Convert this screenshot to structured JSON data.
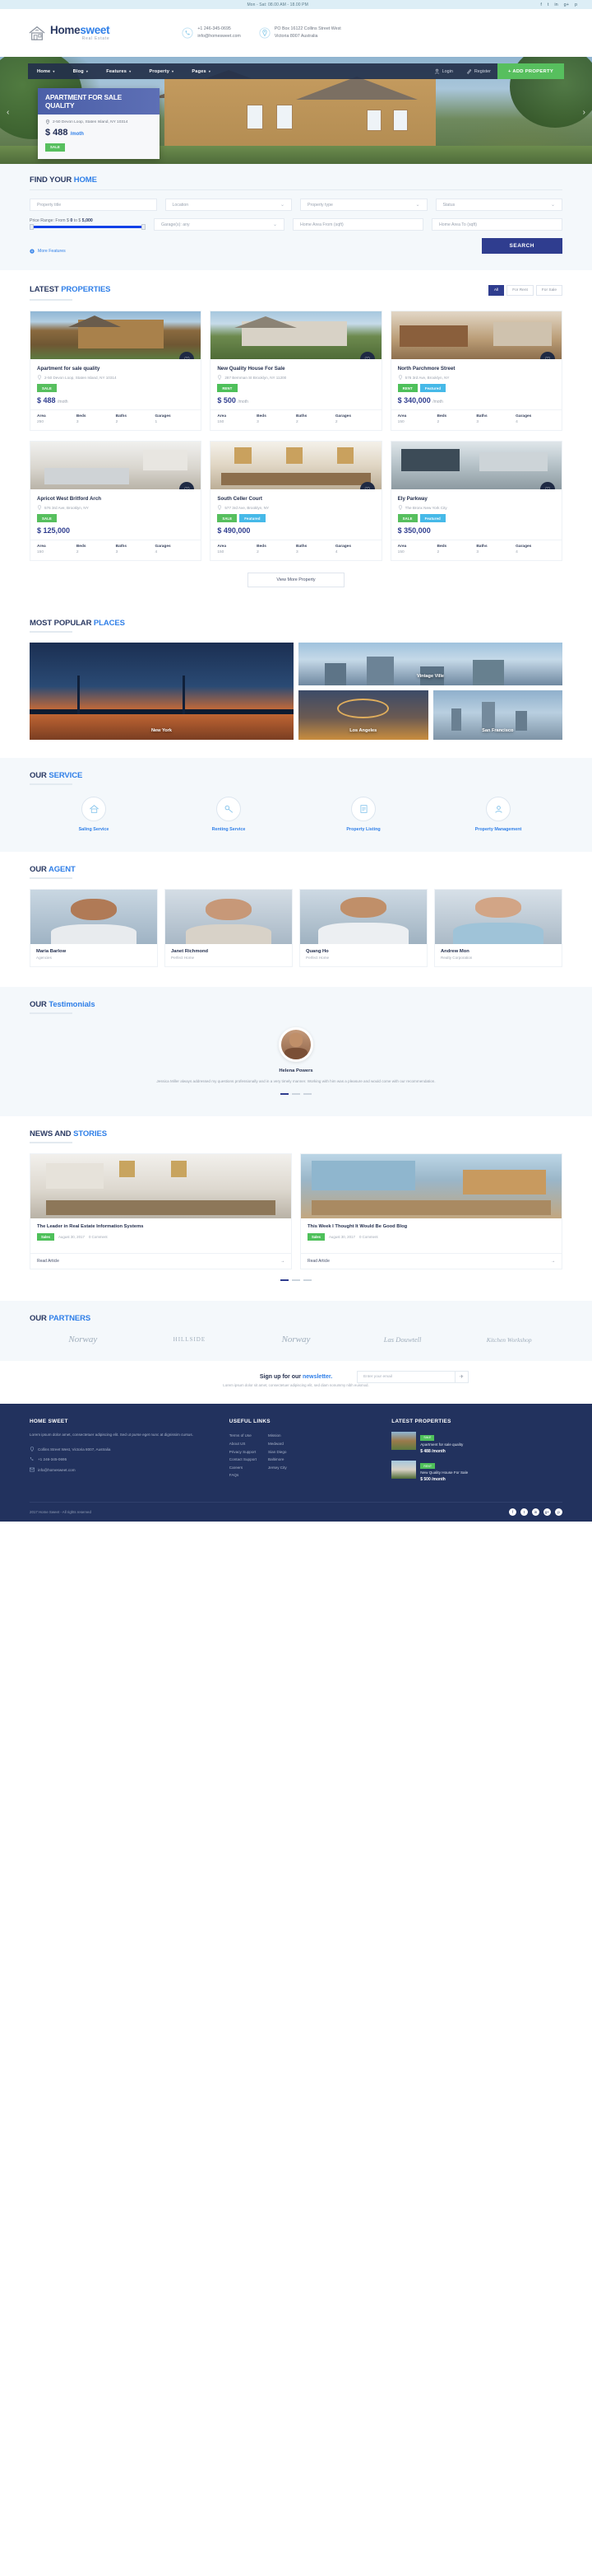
{
  "topbar": {
    "hours": "Mon - Sat: 08.00 AM - 18.00 PM",
    "social": [
      "f",
      "t",
      "in",
      "g+",
      "p"
    ]
  },
  "header": {
    "logo_name_dark": "Home",
    "logo_name_light": "sweet",
    "logo_sub": "Real Estate",
    "logo_icon": "house-icon",
    "contacts": [
      {
        "icon": "phone-icon",
        "line1": "+1 246-345-0695",
        "line2": "info@homesweet.com"
      },
      {
        "icon": "map-pin-icon",
        "line1": "PO Box 16122 Collins Street West",
        "line2": "Victoria 8007 Australia"
      }
    ]
  },
  "nav": {
    "items": [
      "Home",
      "Blog",
      "Features",
      "Property",
      "Pages"
    ],
    "login": "Login",
    "register": "Register",
    "add_property": "+  ADD PROPERTY",
    "add_property_color": "#57bf5e"
  },
  "hero": {
    "title": "APARTMENT FOR SALE QUALITY",
    "address": "2-50 Devon Loop, Staten Island, NY 10314",
    "price": "$ 488",
    "period": "/moth",
    "badge": "SALE",
    "prev": "‹",
    "next": "›"
  },
  "search": {
    "title_dark": "FIND YOUR",
    "title_light": "HOME",
    "property_title_placeholder": "Property title",
    "location": "Location",
    "property_type": "Property type",
    "status": "Status",
    "range_label_pre": "Price Range: From $",
    "range_from": "0",
    "range_mid": "to $",
    "range_to": "5,000",
    "garages": "Garage(s): any",
    "area_from": "Home Area From (sqft)",
    "area_to": "Home Area To (sqft)",
    "other_features": "More Features",
    "search_button": "SEARCH"
  },
  "latest": {
    "title_dark": "LATEST",
    "title_light": "PROPERTIES",
    "tabs": [
      {
        "label": "All",
        "active": true
      },
      {
        "label": "For Rent",
        "active": false
      },
      {
        "label": "For Sale",
        "active": false
      }
    ],
    "more_button": "View More Property",
    "spec_labels": [
      "Area",
      "Beds",
      "Baths",
      "Garages"
    ],
    "cards": [
      {
        "title": "Apartment for sale quality",
        "address": "2-50 Devon Loop, Staten Island, NY 10314",
        "badges": [
          "SALE"
        ],
        "price": "$ 488",
        "period": "/moth",
        "area": "250",
        "beds": "3",
        "baths": "2",
        "garages": "1"
      },
      {
        "title": "New Quality House For Sale",
        "address": "287 Bernman St Brooklyn, NY 11200",
        "badges": [
          "RENT"
        ],
        "price": "$ 500",
        "period": "/moth",
        "area": "150",
        "beds": "3",
        "baths": "2",
        "garages": "2"
      },
      {
        "title": "North Parchmore Street",
        "address": "576 3rd Ave, Brooklyn, NY",
        "badges": [
          "RENT",
          "Featured"
        ],
        "price": "$ 340,000",
        "period": "/moth",
        "area": "150",
        "beds": "2",
        "baths": "3",
        "garages": "4"
      },
      {
        "title": "Apricot West Britford Arch",
        "address": "576 3rd Ave, Brooklyn, NY",
        "badges": [
          "SALE"
        ],
        "price": "$ 125,000",
        "period": "",
        "area": "150",
        "beds": "2",
        "baths": "3",
        "garages": "4"
      },
      {
        "title": "South Celler Court",
        "address": "577 3rd Ave, Brooklyn, NY",
        "badges": [
          "SALE",
          "Featured"
        ],
        "price": "$ 490,000",
        "period": "",
        "area": "150",
        "beds": "2",
        "baths": "3",
        "garages": "4"
      },
      {
        "title": "Ely Parkway",
        "address": "The Bronx New York City",
        "badges": [
          "SALE",
          "Featured"
        ],
        "price": "$ 350,000",
        "period": "",
        "area": "150",
        "beds": "2",
        "baths": "3",
        "garages": "4"
      }
    ]
  },
  "places": {
    "title_dark": "MOST POPULAR",
    "title_light": "PLACES",
    "items": [
      {
        "label": "New York"
      },
      {
        "label": "Vintage Ville"
      },
      {
        "label": "Los Angeles"
      },
      {
        "label": "San Francisco"
      }
    ]
  },
  "services": {
    "title_dark": "OUR",
    "title_light": "SERVICE",
    "items": [
      {
        "icon": "home-icon",
        "label": "Saling Service"
      },
      {
        "icon": "key-icon",
        "label": "Renting Service"
      },
      {
        "icon": "list-icon",
        "label": "Property Listing"
      },
      {
        "icon": "gear-user-icon",
        "label": "Property Management"
      }
    ]
  },
  "agents": {
    "title_dark": "OUR",
    "title_light": "AGENT",
    "items": [
      {
        "name": "Maria Barlow",
        "role": "Agencies"
      },
      {
        "name": "Janet Richmond",
        "role": "Perfect Home"
      },
      {
        "name": "Quang Ho",
        "role": "Perfect Home"
      },
      {
        "name": "Andrew Mon",
        "role": "Realty Corporation"
      }
    ]
  },
  "testimonials": {
    "title_dark": "OUR",
    "title_light": "Testimonials",
    "name": "Helena Powers",
    "text": "Jessica Miller always addressed my questions professionally and in a very timely manner. Working with him was a pleasure and would come with our recommendation.",
    "dots": 3,
    "active_dot": 0
  },
  "news": {
    "title_dark": "NEWS AND",
    "title_light": "STORIES",
    "read_label": "Read Article",
    "arrow": "→",
    "items": [
      {
        "title": "The Leader in Real Estate Information Systems",
        "tag": "Sales",
        "meta": "August 30, 2017",
        "comments": "0 Comment"
      },
      {
        "title": "This Week I Thought It Would Be Good Blog",
        "tag": "Sales",
        "meta": "August 30, 2017",
        "comments": "0 Comment"
      }
    ],
    "dots": 3,
    "active_dot": 0
  },
  "partners": {
    "title_dark": "OUR",
    "title_light": "PARTNERS",
    "items": [
      "Norway",
      "HILLSIDE",
      "Norway",
      "Las Douwtell",
      "Kitchen Workshop"
    ]
  },
  "newsletter": {
    "title_dark": "Sign up for our",
    "title_light": "newsletter.",
    "subtitle": "Lorem ipsum dolor sit amet, consectetuer adipiscing elit, sed diam nonummy nibh euismod.",
    "placeholder": "Enter your email",
    "button_icon": "send-icon"
  },
  "footer": {
    "col1": {
      "heading": "HOME SWEET",
      "text": "Lorem ipsum dolor amet, consectetuer adipiscing elit. Sed ut purse eget nunc at dignissim cursus.",
      "contacts": [
        {
          "icon": "map-pin-icon",
          "text": "Collins Street West, Victoria 8007, Australia"
        },
        {
          "icon": "phone-icon",
          "text": "+1 246-345-0695"
        },
        {
          "icon": "mail-icon",
          "text": "info@homesweet.com"
        }
      ]
    },
    "col2": {
      "heading": "USEFUL LINKS",
      "links_a": [
        "Terms of Use",
        "About US",
        "Privacy Support",
        "Contact Support",
        "Careers",
        "FAQs"
      ],
      "links_b": [
        "Mission",
        "Medward",
        "Sian Diego",
        "Baltimore",
        "Jersey City"
      ]
    },
    "col3": {
      "heading": "LATEST PROPERTIES",
      "items": [
        {
          "badge": "SALE",
          "title": "Apartment for sale quality",
          "price": "$ 488 /month"
        },
        {
          "badge": "RENT",
          "title": "New Quality House For Sale",
          "price": "$ 500 /month"
        }
      ]
    },
    "copyright": "2017 Home Sweet - All rights reserved",
    "social": [
      "f",
      "t",
      "in",
      "g+",
      "p"
    ]
  }
}
